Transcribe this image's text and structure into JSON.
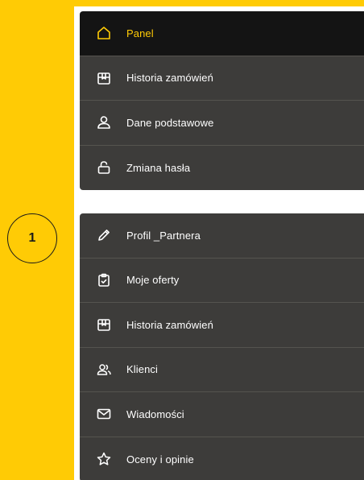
{
  "colors": {
    "accent": "#FFCB05",
    "menu_bg": "#3d3c3a",
    "menu_active_bg": "#141414",
    "panel": "#ffffff"
  },
  "step_number": "1",
  "account_menu": {
    "items": [
      {
        "label": "Panel",
        "icon": "home-icon",
        "active": true
      },
      {
        "label": "Historia zamówień",
        "icon": "package-icon",
        "active": false
      },
      {
        "label": "Dane podstawowe",
        "icon": "user-icon",
        "active": false
      },
      {
        "label": "Zmiana hasła",
        "icon": "lock-icon",
        "active": false
      }
    ]
  },
  "partner_menu": {
    "items": [
      {
        "label": "Profil _Partnera",
        "icon": "pencil-icon"
      },
      {
        "label": "Moje oferty",
        "icon": "clipboard-check-icon"
      },
      {
        "label": "Historia zamówień",
        "icon": "package-icon"
      },
      {
        "label": "Klienci",
        "icon": "users-icon"
      },
      {
        "label": "Wiadomości",
        "icon": "mail-icon"
      },
      {
        "label": "Oceny i opinie",
        "icon": "star-icon"
      }
    ]
  }
}
